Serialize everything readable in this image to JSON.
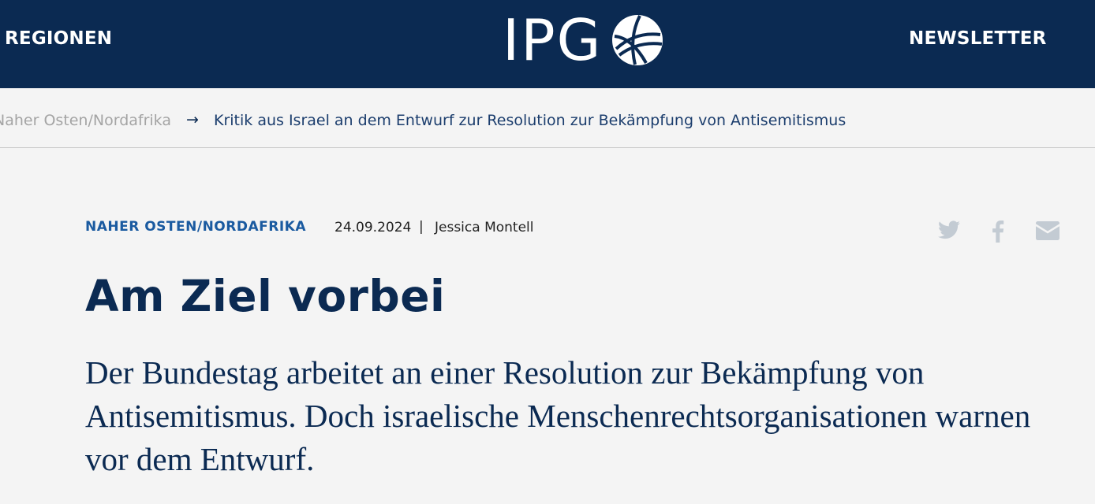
{
  "header": {
    "nav_left": "REGIONEN",
    "nav_right": "NEWSLETTER",
    "logo_text": "IPG",
    "background_color": "#0b2a52"
  },
  "breadcrumb": {
    "previous": "Naher Osten/Nordafrika",
    "arrow": "→",
    "current": "Kritik aus Israel an dem Entwurf zur Resolution zur Bekämpfung von Antisemitismus"
  },
  "article": {
    "category": "NAHER OSTEN/NORDAFRIKA",
    "date": "24.09.2024",
    "separator": "|",
    "author": "Jessica Montell",
    "title": "Am Ziel vorbei",
    "lead": "Der Bundestag arbeitet an einer Resolution zur Bekämpfung von Antisemitismus. Doch israelische Menschenrechtsorganisationen warnen vor dem Entwurf."
  },
  "share": {
    "icons": [
      "twitter-icon",
      "facebook-icon",
      "mail-icon"
    ],
    "icon_color": "#c3cbd3"
  }
}
